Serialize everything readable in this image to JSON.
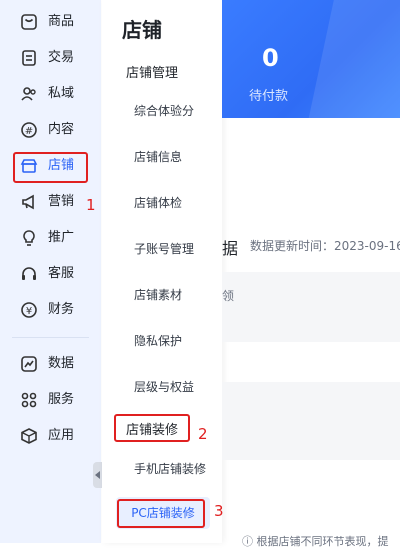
{
  "rail": {
    "items": [
      {
        "label": "商品",
        "icon": "product-icon"
      },
      {
        "label": "交易",
        "icon": "trade-icon"
      },
      {
        "label": "私域",
        "icon": "private-domain-icon"
      },
      {
        "label": "内容",
        "icon": "content-icon"
      },
      {
        "label": "店铺",
        "icon": "store-icon"
      },
      {
        "label": "营销",
        "icon": "megaphone-icon"
      },
      {
        "label": "推广",
        "icon": "lightbulb-icon"
      },
      {
        "label": "客服",
        "icon": "headset-icon"
      },
      {
        "label": "财务",
        "icon": "finance-icon"
      },
      {
        "label": "数据",
        "icon": "chart-icon"
      },
      {
        "label": "服务",
        "icon": "apps-icon"
      },
      {
        "label": "应用",
        "icon": "cube-icon"
      }
    ],
    "active_color": "#2b63f6"
  },
  "submenu": {
    "title": "店铺",
    "group1": "店铺管理",
    "items1": [
      "综合体验分",
      "店铺信息",
      "店铺体检",
      "子账号管理",
      "店铺素材",
      "隐私保护",
      "层级与权益"
    ],
    "group2": "店铺装修",
    "items2": [
      "手机店铺装修",
      "PC店铺装修"
    ]
  },
  "annotations": {
    "n1": "1",
    "n2": "2",
    "n3": "3",
    "color": "#e02020"
  },
  "main": {
    "stat_value": "0",
    "stat_label": "待付款",
    "section_title_fragment": "据",
    "update_text": "数据更新时间：2023-09-16",
    "card_fragment": "领",
    "hint_text": "ⓘ 根据店铺不同环节表现，提"
  }
}
